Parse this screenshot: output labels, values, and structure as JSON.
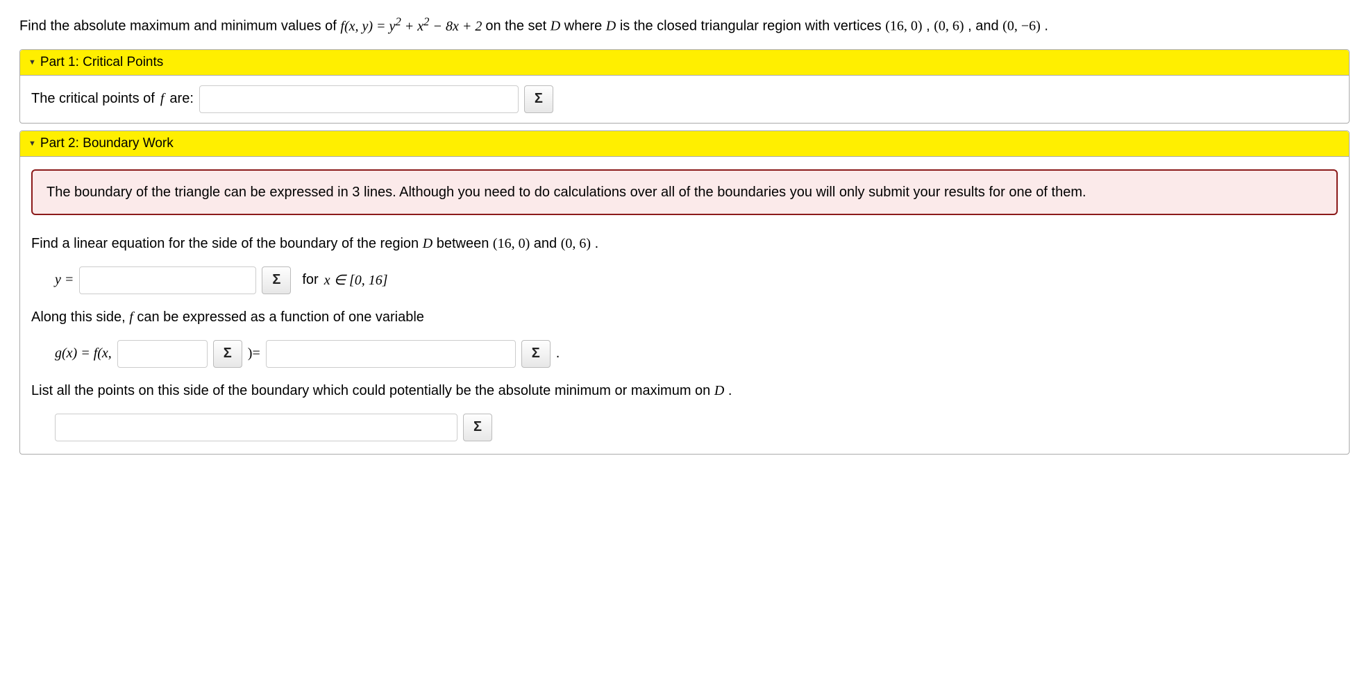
{
  "problem": {
    "prefix": "Find the absolute maximum and minimum values of ",
    "func_lhs": "f(x, y) = y",
    "func_mid1": " + x",
    "func_mid2": " − 8x + 2",
    "between": " on the set ",
    "D": "D",
    "where": " where ",
    "rest": " is the closed triangular region with vertices ",
    "v1": "(16, 0)",
    "sep1": ", ",
    "v2": "(0, 6)",
    "sep2": ", and ",
    "v3": "(0, −6)",
    "period": "."
  },
  "part1": {
    "title": "Part 1: Critical Points",
    "label_pre": "The critical points of ",
    "label_f": "f",
    "label_post": " are:"
  },
  "part2": {
    "title": "Part 2: Boundary Work",
    "notice": "The boundary of the triangle can be expressed in 3 lines. Although you need to do calculations over all of the boundaries you will only submit your results for one of them.",
    "line_eq_pre": "Find a linear equation for the side of the boundary of the region ",
    "D": "D",
    "line_eq_mid": " between ",
    "pt1": "(16, 0)",
    "and": " and ",
    "pt2": "(0, 6)",
    "period": ".",
    "y_eq": "y =",
    "for_x": "for ",
    "x_in": "x ∈ [0, 16]",
    "along_pre": "Along this side, ",
    "f": "f",
    "along_post": " can be expressed as a function of one variable",
    "g_lhs": "g(x) = f(x,",
    "g_rhs": ")=",
    "dot": ".",
    "list_pre": "List all the points on this side of the boundary which could potentially be the absolute minimum or maximum on ",
    "list_D": "D",
    "list_post": "."
  },
  "sigma": "Σ"
}
